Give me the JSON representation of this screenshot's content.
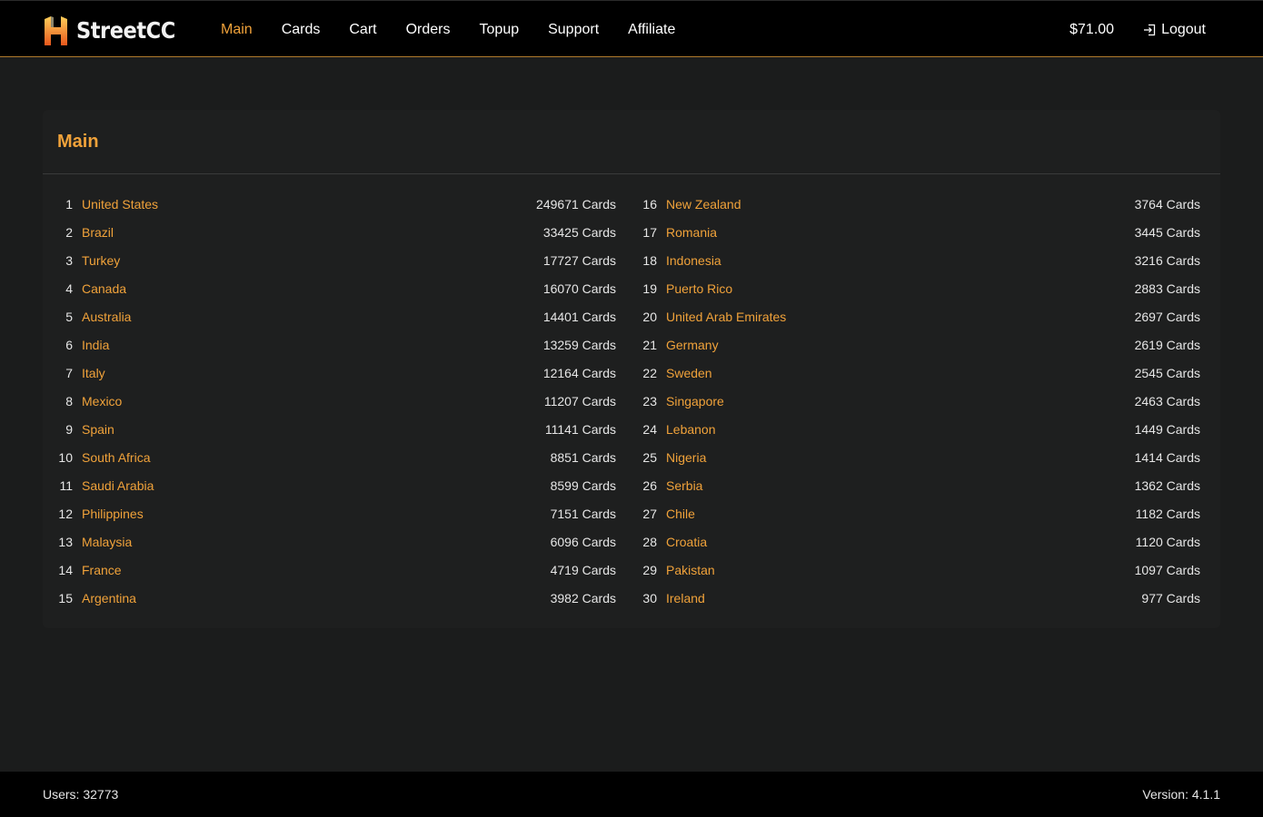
{
  "brand": {
    "name": "StreetCC"
  },
  "nav": {
    "items": [
      {
        "label": "Main",
        "active": true
      },
      {
        "label": "Cards",
        "active": false
      },
      {
        "label": "Cart",
        "active": false
      },
      {
        "label": "Orders",
        "active": false
      },
      {
        "label": "Topup",
        "active": false
      },
      {
        "label": "Support",
        "active": false
      },
      {
        "label": "Affiliate",
        "active": false
      }
    ],
    "balance": "$71.00",
    "logout": "Logout"
  },
  "main": {
    "title": "Main",
    "countries_left": [
      {
        "rank": "1",
        "name": "United States",
        "count": "249671 Cards"
      },
      {
        "rank": "2",
        "name": "Brazil",
        "count": "33425 Cards"
      },
      {
        "rank": "3",
        "name": "Turkey",
        "count": "17727 Cards"
      },
      {
        "rank": "4",
        "name": "Canada",
        "count": "16070 Cards"
      },
      {
        "rank": "5",
        "name": "Australia",
        "count": "14401 Cards"
      },
      {
        "rank": "6",
        "name": "India",
        "count": "13259 Cards"
      },
      {
        "rank": "7",
        "name": "Italy",
        "count": "12164 Cards"
      },
      {
        "rank": "8",
        "name": "Mexico",
        "count": "11207 Cards"
      },
      {
        "rank": "9",
        "name": "Spain",
        "count": "11141 Cards"
      },
      {
        "rank": "10",
        "name": "South Africa",
        "count": "8851 Cards"
      },
      {
        "rank": "11",
        "name": "Saudi Arabia",
        "count": "8599 Cards"
      },
      {
        "rank": "12",
        "name": "Philippines",
        "count": "7151 Cards"
      },
      {
        "rank": "13",
        "name": "Malaysia",
        "count": "6096 Cards"
      },
      {
        "rank": "14",
        "name": "France",
        "count": "4719 Cards"
      },
      {
        "rank": "15",
        "name": "Argentina",
        "count": "3982 Cards"
      }
    ],
    "countries_right": [
      {
        "rank": "16",
        "name": "New Zealand",
        "count": "3764 Cards"
      },
      {
        "rank": "17",
        "name": "Romania",
        "count": "3445 Cards"
      },
      {
        "rank": "18",
        "name": "Indonesia",
        "count": "3216 Cards"
      },
      {
        "rank": "19",
        "name": "Puerto Rico",
        "count": "2883 Cards"
      },
      {
        "rank": "20",
        "name": "United Arab Emirates",
        "count": "2697 Cards"
      },
      {
        "rank": "21",
        "name": "Germany",
        "count": "2619 Cards"
      },
      {
        "rank": "22",
        "name": "Sweden",
        "count": "2545 Cards"
      },
      {
        "rank": "23",
        "name": "Singapore",
        "count": "2463 Cards"
      },
      {
        "rank": "24",
        "name": "Lebanon",
        "count": "1449 Cards"
      },
      {
        "rank": "25",
        "name": "Nigeria",
        "count": "1414 Cards"
      },
      {
        "rank": "26",
        "name": "Serbia",
        "count": "1362 Cards"
      },
      {
        "rank": "27",
        "name": "Chile",
        "count": "1182 Cards"
      },
      {
        "rank": "28",
        "name": "Croatia",
        "count": "1120 Cards"
      },
      {
        "rank": "29",
        "name": "Pakistan",
        "count": "1097 Cards"
      },
      {
        "rank": "30",
        "name": "Ireland",
        "count": "977 Cards"
      }
    ]
  },
  "footer": {
    "users": "Users: 32773",
    "version": "Version: 4.1.1"
  },
  "colors": {
    "accent": "#f0a23a",
    "background": "#1b1c1c",
    "navbar": "#000000"
  },
  "icons": {
    "brand": "flame-building-logo-icon",
    "logout": "logout-icon"
  }
}
